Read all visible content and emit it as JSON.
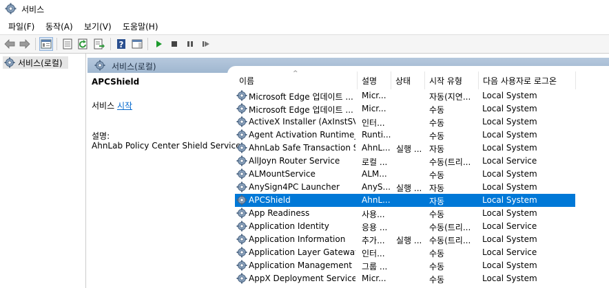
{
  "window": {
    "title": "서비스"
  },
  "menu": [
    "파일(F)",
    "동작(A)",
    "보기(V)",
    "도움말(H)"
  ],
  "toolbar": [
    {
      "name": "back-icon"
    },
    {
      "name": "forward-icon"
    },
    {
      "name": "show-hide-console-tree-icon"
    },
    {
      "name": "properties-icon"
    },
    {
      "name": "refresh-icon"
    },
    {
      "name": "export-list-icon"
    },
    {
      "name": "help-icon"
    },
    {
      "name": "action-pane-icon"
    },
    {
      "name": "start-service-icon"
    },
    {
      "name": "stop-service-icon"
    },
    {
      "name": "pause-service-icon"
    },
    {
      "name": "restart-service-icon"
    }
  ],
  "tree": {
    "root_label": "서비스(로컬)"
  },
  "content": {
    "header_label": "서비스(로컬)",
    "selected_name": "APCShield",
    "start_prefix": "서비스 ",
    "start_link": "시작",
    "description_label": "설명:",
    "description_text": "AhnLab Policy Center Shield Service"
  },
  "columns": [
    "이름",
    "설명",
    "상태",
    "시작 유형",
    "다음 사용자로 로그온"
  ],
  "rows": [
    {
      "name": "Microsoft Edge 업데이트 ...",
      "desc": "Micr...",
      "state": "",
      "start": "자동(지연...",
      "logon": "Local System"
    },
    {
      "name": "Microsoft Edge 업데이트 ...",
      "desc": "Micr...",
      "state": "",
      "start": "수동",
      "logon": "Local System"
    },
    {
      "name": "ActiveX Installer (AxInstSV)",
      "desc": "인터...",
      "state": "",
      "start": "수동",
      "logon": "Local System"
    },
    {
      "name": "Agent Activation Runtime_...",
      "desc": "Runti...",
      "state": "",
      "start": "수동",
      "logon": "Local System"
    },
    {
      "name": "AhnLab Safe Transaction S...",
      "desc": "AhnL...",
      "state": "실행 ...",
      "start": "자동",
      "logon": "Local System"
    },
    {
      "name": "AllJoyn Router Service",
      "desc": "로컬 ...",
      "state": "",
      "start": "수동(트리...",
      "logon": "Local Service"
    },
    {
      "name": "ALMountService",
      "desc": "ALM...",
      "state": "",
      "start": "수동",
      "logon": "Local System"
    },
    {
      "name": "AnySign4PC Launcher",
      "desc": "AnyS...",
      "state": "실행 ...",
      "start": "자동",
      "logon": "Local System"
    },
    {
      "name": "APCShield",
      "desc": "AhnL...",
      "state": "",
      "start": "자동",
      "logon": "Local System",
      "selected": true
    },
    {
      "name": "App Readiness",
      "desc": "사용...",
      "state": "",
      "start": "수동",
      "logon": "Local System"
    },
    {
      "name": "Application Identity",
      "desc": "응용 ...",
      "state": "",
      "start": "수동(트리...",
      "logon": "Local Service"
    },
    {
      "name": "Application Information",
      "desc": "추가...",
      "state": "실행 ...",
      "start": "수동(트리...",
      "logon": "Local System"
    },
    {
      "name": "Application Layer Gateway ...",
      "desc": "인터...",
      "state": "",
      "start": "수동",
      "logon": "Local Service"
    },
    {
      "name": "Application Management",
      "desc": "그룹 ...",
      "state": "",
      "start": "수동",
      "logon": "Local System"
    },
    {
      "name": "AppX Deployment Service ...",
      "desc": "Micr...",
      "state": "",
      "start": "수동",
      "logon": "Local System"
    }
  ],
  "colors": {
    "selection": "#0078d7",
    "link": "#0066cc",
    "header_band": "#a9bfd7"
  }
}
